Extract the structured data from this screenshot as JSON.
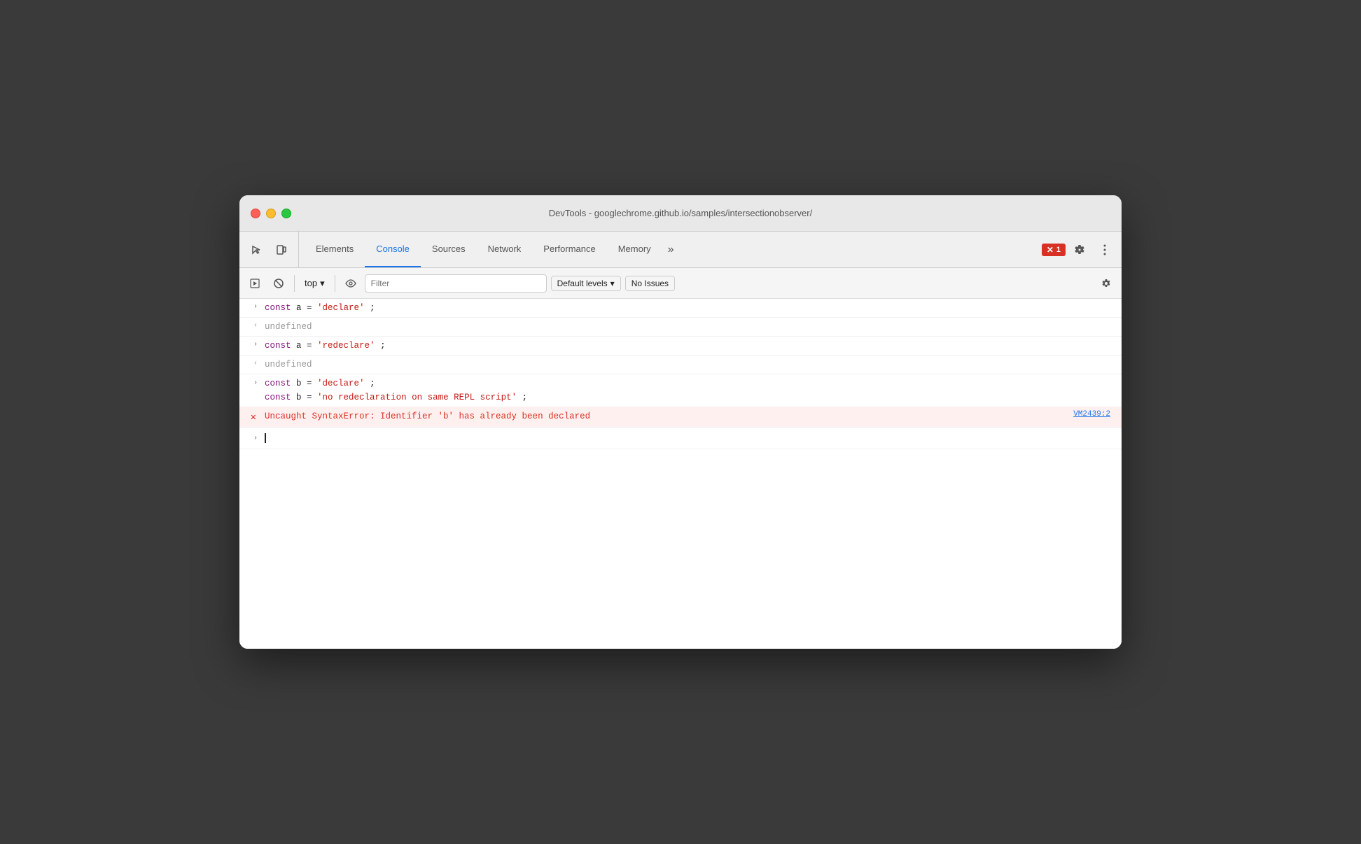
{
  "window": {
    "title": "DevTools - googlechrome.github.io/samples/intersectionobserver/"
  },
  "tabs": {
    "items": [
      {
        "id": "elements",
        "label": "Elements",
        "active": false
      },
      {
        "id": "console",
        "label": "Console",
        "active": true
      },
      {
        "id": "sources",
        "label": "Sources",
        "active": false
      },
      {
        "id": "network",
        "label": "Network",
        "active": false
      },
      {
        "id": "performance",
        "label": "Performance",
        "active": false
      },
      {
        "id": "memory",
        "label": "Memory",
        "active": false
      }
    ],
    "more_label": "»",
    "error_count": "1",
    "gear_label": "⚙",
    "more_menu_label": "⋮"
  },
  "toolbar": {
    "run_label": "▶",
    "clear_label": "🚫",
    "context_label": "top",
    "dropdown_arrow": "▾",
    "eye_label": "👁",
    "filter_placeholder": "Filter",
    "levels_label": "Default levels",
    "levels_arrow": "▾",
    "issues_label": "No Issues",
    "gear_label": "⚙"
  },
  "console": {
    "lines": [
      {
        "type": "input",
        "gutter": "›",
        "code": "const a = 'declare';"
      },
      {
        "type": "output",
        "gutter": "‹",
        "text": "undefined"
      },
      {
        "type": "input",
        "gutter": "›",
        "code": "const a = 'redeclare';"
      },
      {
        "type": "output",
        "gutter": "‹",
        "text": "undefined"
      },
      {
        "type": "input",
        "gutter": "›",
        "code_line1": "const b = 'declare';",
        "code_line2": "const b = 'no redeclaration on same REPL script';"
      },
      {
        "type": "error",
        "gutter": "✕",
        "text": "Uncaught SyntaxError: Identifier 'b' has already been declared",
        "link": "VM2439:2"
      }
    ],
    "input_prompt": "›"
  },
  "colors": {
    "accent_blue": "#1a73e8",
    "error_red": "#d93025",
    "code_purple": "#881280",
    "code_blue": "#1c00cf",
    "code_red": "#c41a16"
  }
}
